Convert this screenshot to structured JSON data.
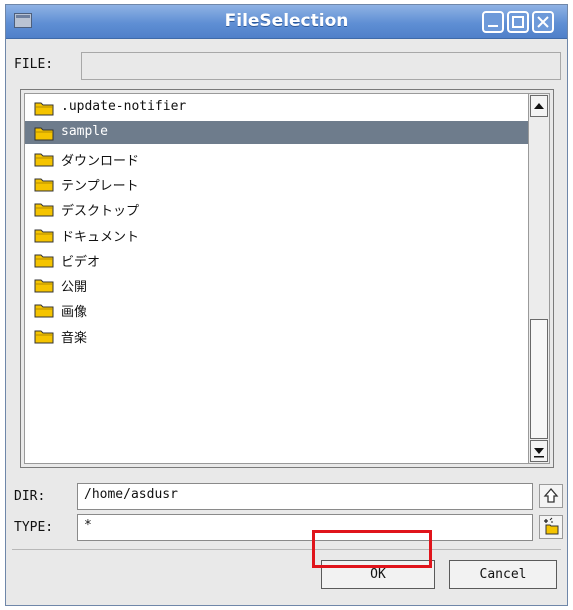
{
  "window": {
    "title": "FileSelection"
  },
  "file_field": {
    "label": "FILE:",
    "value": ""
  },
  "list": {
    "items": [
      {
        "name": ".update-notifier",
        "selected": false
      },
      {
        "name": "sample",
        "selected": true
      },
      {
        "name": "ダウンロード",
        "selected": false
      },
      {
        "name": "テンプレート",
        "selected": false
      },
      {
        "name": "デスクトップ",
        "selected": false
      },
      {
        "name": "ドキュメント",
        "selected": false
      },
      {
        "name": "ビデオ",
        "selected": false
      },
      {
        "name": "公開",
        "selected": false
      },
      {
        "name": "画像",
        "selected": false
      },
      {
        "name": "音楽",
        "selected": false
      }
    ]
  },
  "dir_field": {
    "label": "DIR:",
    "value": "/home/asdusr"
  },
  "type_field": {
    "label": "TYPE:",
    "value": "*"
  },
  "buttons": {
    "ok": "OK",
    "cancel": "Cancel"
  },
  "icons": {
    "app": "window-menu-icon",
    "minimize": "minimize-icon",
    "maximize": "maximize-icon",
    "close": "close-icon",
    "folder": "folder-icon",
    "up_dir": "up-directory-icon",
    "new_folder": "new-folder-icon"
  },
  "colors": {
    "titlebar": "#5f8fd4",
    "selection": "#6e7c8c",
    "folder": "#f5c400",
    "focus_highlight": "#e0141b"
  }
}
